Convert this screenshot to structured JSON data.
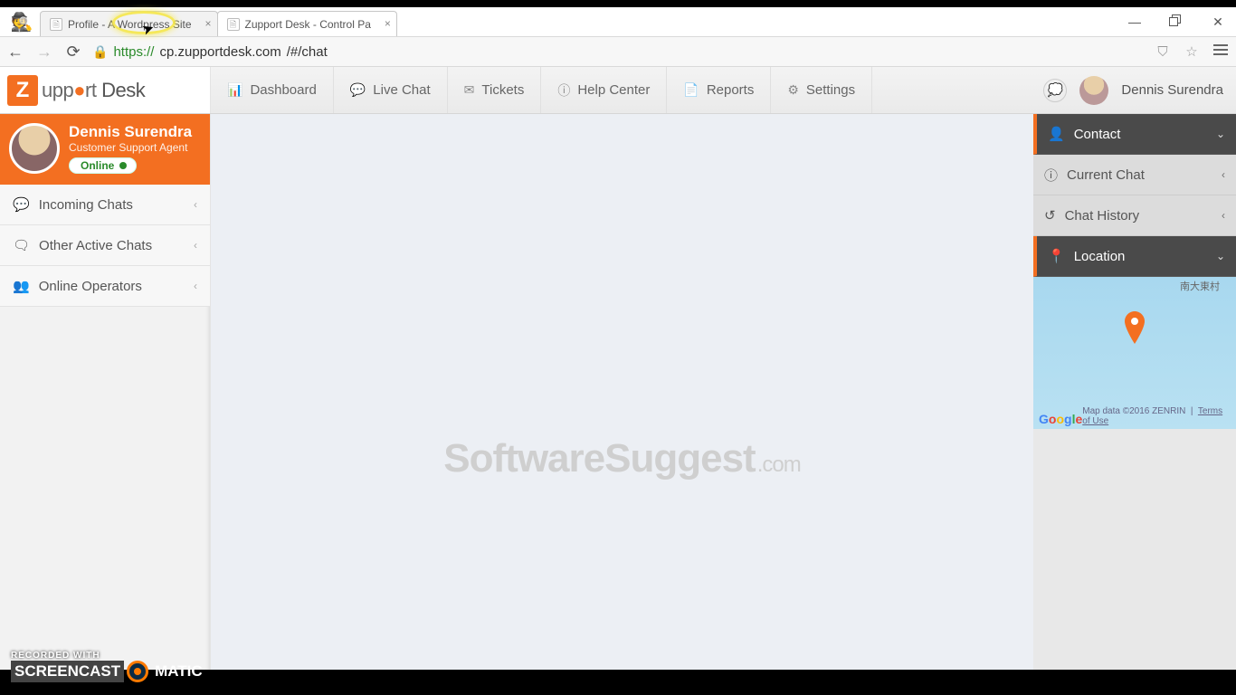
{
  "browser": {
    "tabs": [
      {
        "title": "Profile - A Wordpress Site",
        "active": false
      },
      {
        "title": "Zupport Desk - Control Pa",
        "active": true
      }
    ],
    "url_scheme": "https://",
    "url_host": "cp.zupportdesk.com",
    "url_path": "/#/chat",
    "window_controls": {
      "min": "—",
      "max": "❐",
      "close": "✕"
    }
  },
  "app": {
    "logo_text": "upport Desk",
    "topnav": [
      {
        "icon": "dashboard-icon",
        "label": "Dashboard"
      },
      {
        "icon": "chat-icon",
        "label": "Live Chat"
      },
      {
        "icon": "mail-icon",
        "label": "Tickets"
      },
      {
        "icon": "info-icon",
        "label": "Help Center"
      },
      {
        "icon": "file-icon",
        "label": "Reports"
      },
      {
        "icon": "gears-icon",
        "label": "Settings"
      }
    ],
    "header_user": "Dennis Surendra"
  },
  "sidebar": {
    "name": "Dennis Surendra",
    "role": "Customer Support Agent",
    "status": "Online",
    "items": [
      {
        "icon": "comment-icon",
        "label": "Incoming Chats"
      },
      {
        "icon": "comments-icon",
        "label": "Other Active Chats"
      },
      {
        "icon": "users-icon",
        "label": "Online Operators"
      }
    ]
  },
  "rightpanel": {
    "contact": "Contact",
    "current_chat": "Current Chat",
    "chat_history": "Chat History",
    "location": "Location",
    "map": {
      "label_cjk": "南大東村",
      "attribution": "Map data ©2016 ZENRIN",
      "terms": "Terms of Use"
    }
  },
  "watermark": {
    "main": "SoftwareSuggest",
    "suffix": ".com"
  },
  "recorder": {
    "tag": "RECORDED WITH",
    "p1": "SCREENCAST",
    "p3": "MATIC"
  },
  "colors": {
    "accent": "#f36f21",
    "online": "#2a8a2a"
  }
}
